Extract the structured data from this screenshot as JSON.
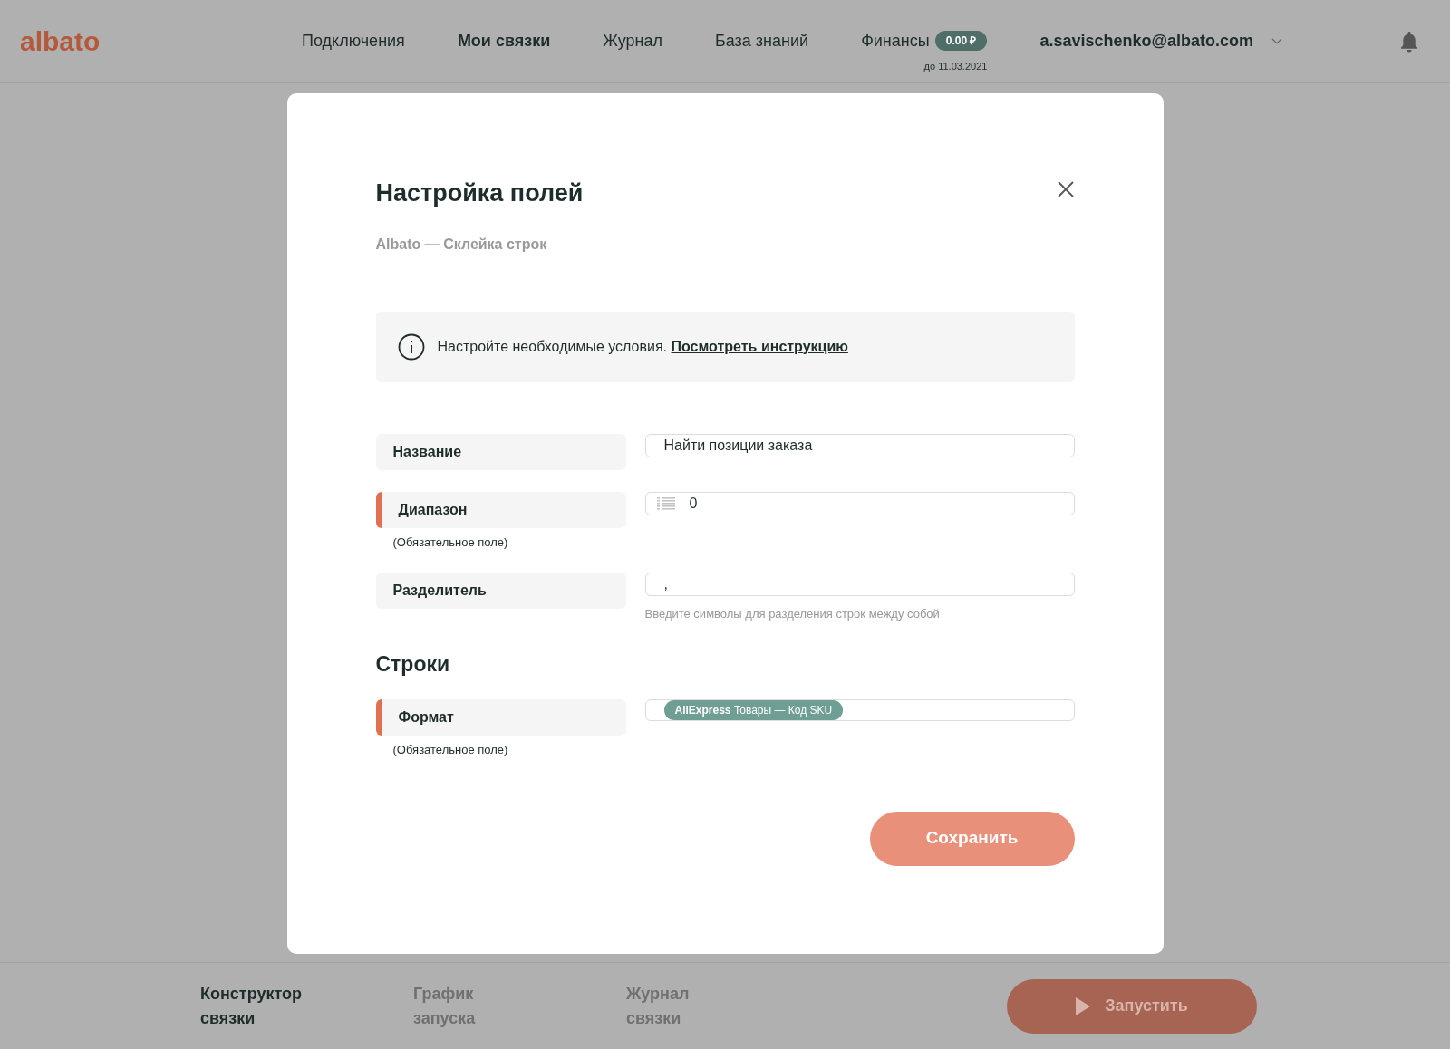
{
  "header": {
    "logo": "albato",
    "nav": [
      {
        "label": "Подключения",
        "selected": false
      },
      {
        "label": "Мои связки",
        "selected": true
      },
      {
        "label": "Журнал",
        "selected": false
      },
      {
        "label": "База знаний",
        "selected": false
      }
    ],
    "finance": {
      "label": "Финансы",
      "balance": "0.00 ₽",
      "until": "до 11.03.2021"
    },
    "user": "a.savischenko@albato.com"
  },
  "modal": {
    "title": "Настройка полей",
    "subtitle": "Albato — Склейка строк",
    "info": {
      "text": "Настройте необходимые условия.",
      "link": "Посмотреть инструкцию"
    },
    "fields": [
      {
        "kind": "text",
        "label": "Название",
        "required": false,
        "value": "Найти позиции заказа"
      },
      {
        "kind": "list",
        "label": "Диапазон",
        "required": true,
        "required_note": "(Обязательное поле)",
        "value": "0"
      },
      {
        "kind": "text",
        "label": "Разделитель",
        "required": false,
        "value": ",",
        "hint": "Введите символы для разделения строк между собой"
      }
    ],
    "section": "Строки",
    "section_fields": [
      {
        "kind": "tags",
        "label": "Формат",
        "required": true,
        "required_note": "(Обязательное поле)",
        "tags": [
          "**AliExpress** Товары — Код SKU"
        ]
      }
    ],
    "save": "Сохранить"
  },
  "footer": {
    "tabs": [
      {
        "label": "Конструктор\nсвязки",
        "selected": true
      },
      {
        "label": "График\nзапуска",
        "selected": false
      },
      {
        "label": "Журнал\nсвязки",
        "selected": false
      }
    ],
    "run": "Запустить"
  }
}
